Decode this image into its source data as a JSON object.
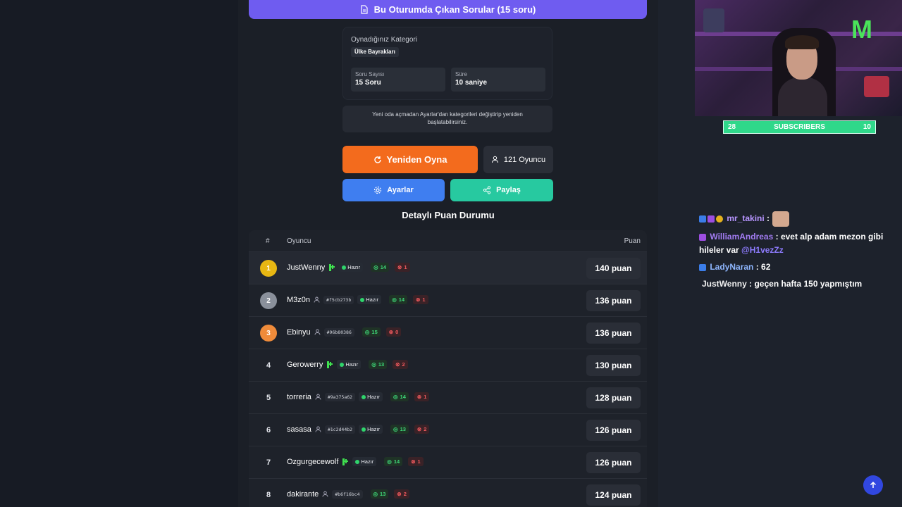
{
  "top_button": {
    "label": "Bu Oturumda Çıkan Sorular (15 soru)"
  },
  "category_card": {
    "label": "Oynadığınız Kategori",
    "category": "Ülke Bayrakları",
    "question_count_label": "Soru Sayısı",
    "question_count_value": "15 Soru",
    "duration_label": "Süre",
    "duration_value": "10 saniye"
  },
  "note": "Yeni oda açmadan Ayarlar'dan kategorileri değiştirip yeniden başlatabilirsiniz.",
  "actions": {
    "replay": "Yeniden Oyna",
    "players": "121 Oyuncu",
    "settings": "Ayarlar",
    "share": "Paylaş"
  },
  "section_title": "Detaylı Puan Durumu",
  "table": {
    "headers": {
      "num": "#",
      "player": "Oyuncu",
      "score": "Puan"
    },
    "rows": [
      {
        "rank": "1",
        "name": "JustWenny",
        "type": "kick",
        "tag": "",
        "ready": "Hazır",
        "correct": "14",
        "wrong": "1",
        "score": "140 puan"
      },
      {
        "rank": "2",
        "name": "M3z0n",
        "type": "user",
        "tag": "#f5cb273b",
        "ready": "Hazır",
        "correct": "14",
        "wrong": "1",
        "score": "136 puan"
      },
      {
        "rank": "3",
        "name": "Ebinyu",
        "type": "user",
        "tag": "#96b80386",
        "ready": "",
        "correct": "15",
        "wrong": "0",
        "score": "136 puan"
      },
      {
        "rank": "4",
        "name": "Gerowerry",
        "type": "kick",
        "tag": "",
        "ready": "Hazır",
        "correct": "13",
        "wrong": "2",
        "score": "130 puan"
      },
      {
        "rank": "5",
        "name": "torreria",
        "type": "user",
        "tag": "#9a375a62",
        "ready": "Hazır",
        "correct": "14",
        "wrong": "1",
        "score": "128 puan"
      },
      {
        "rank": "6",
        "name": "sasasa",
        "type": "user",
        "tag": "#1c2d44b2",
        "ready": "Hazır",
        "correct": "13",
        "wrong": "2",
        "score": "126 puan"
      },
      {
        "rank": "7",
        "name": "Ozgurgecewolf",
        "type": "kick",
        "tag": "",
        "ready": "Hazır",
        "correct": "14",
        "wrong": "1",
        "score": "126 puan"
      },
      {
        "rank": "8",
        "name": "dakirante",
        "type": "user",
        "tag": "#b6f16bc4",
        "ready": "",
        "correct": "13",
        "wrong": "2",
        "score": "124 puan"
      }
    ]
  },
  "stream": {
    "sub_left": "28",
    "sub_label": "SUBSCRIBERS",
    "sub_right": "10",
    "chat": [
      {
        "user": "mr_takini",
        "text": ""
      },
      {
        "user": "WilliamAndreas",
        "text": "evet alp adam mezon gibi hileler var",
        "mention": "@H1vezZz"
      },
      {
        "user": "LadyNaran",
        "text": "62"
      },
      {
        "user": "JustWenny",
        "text": "geçen hafta 150 yapmıştım"
      }
    ]
  },
  "colors": {
    "purple": "#6f5cf0",
    "orange": "#f36b1d",
    "blue": "#3f7ef0",
    "teal": "#27c9a0",
    "green": "#2fd46b",
    "red": "#f0595d"
  }
}
